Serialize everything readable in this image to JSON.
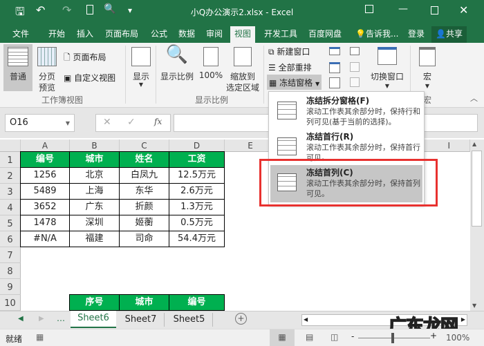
{
  "window": {
    "title": "小Q办公演示2.xlsx - Excel"
  },
  "tabs": [
    "文件",
    "开始",
    "插入",
    "页面布局",
    "公式",
    "数据",
    "审阅",
    "视图",
    "开发工具",
    "百度网盘"
  ],
  "active_tab": "视图",
  "tell_me": "告诉我...",
  "login": "登录",
  "share": "共享",
  "ribbon": {
    "normal": "普通",
    "page_break_1": "分页",
    "page_break_2": "预览",
    "page_layout": "页面布局",
    "custom_view": "自定义视图",
    "group_workbook_views": "工作簿视图",
    "show": "显示",
    "zoom": "显示比例",
    "zoom100": "100%",
    "zoom_sel_1": "缩放到",
    "zoom_sel_2": "选定区域",
    "group_zoom": "显示比例",
    "new_window": "新建窗口",
    "arrange_all": "全部重排",
    "freeze_panes": "冻结窗格",
    "switch_windows": "切换窗口",
    "macros": "宏",
    "group_macros": "宏"
  },
  "freeze_menu": [
    {
      "title": "冻结拆分窗格(F)",
      "desc": "滚动工作表其余部分时，保持行和列可见(基于当前的选择)。"
    },
    {
      "title": "冻结首行(R)",
      "desc": "滚动工作表其余部分时，保持首行可见。"
    },
    {
      "title": "冻结首列(C)",
      "desc": "滚动工作表其余部分时，保持首列可见。",
      "highlighted": true
    }
  ],
  "formula_bar": {
    "name_box": "O16",
    "fx": "fx",
    "value": ""
  },
  "columns": [
    "A",
    "B",
    "C",
    "D",
    "E",
    "I"
  ],
  "rows": [
    "1",
    "2",
    "3",
    "4",
    "5",
    "6",
    "7",
    "8",
    "9",
    "10"
  ],
  "table1": {
    "headers": [
      "编号",
      "城市",
      "姓名",
      "工资"
    ],
    "rows": [
      [
        "1256",
        "北京",
        "白凤九",
        "12.5万元"
      ],
      [
        "5489",
        "上海",
        "东华",
        "2.6万元"
      ],
      [
        "3652",
        "广东",
        "折颜",
        "1.3万元"
      ],
      [
        "1478",
        "深圳",
        "姬蘅",
        "0.5万元"
      ],
      [
        "#N/A",
        "福建",
        "司命",
        "54.4万元"
      ]
    ]
  },
  "table2": {
    "headers": [
      "序号",
      "城市",
      "编号"
    ]
  },
  "sheets": [
    "Sheet6",
    "Sheet7",
    "Sheet5"
  ],
  "active_sheet": "Sheet6",
  "status": {
    "ready": "就绪",
    "zoom": "100%"
  },
  "watermark": "广东龙网",
  "colors": {
    "excel_green": "#217346",
    "header_fill": "#00b050",
    "highlight_box": "#e8312f"
  }
}
